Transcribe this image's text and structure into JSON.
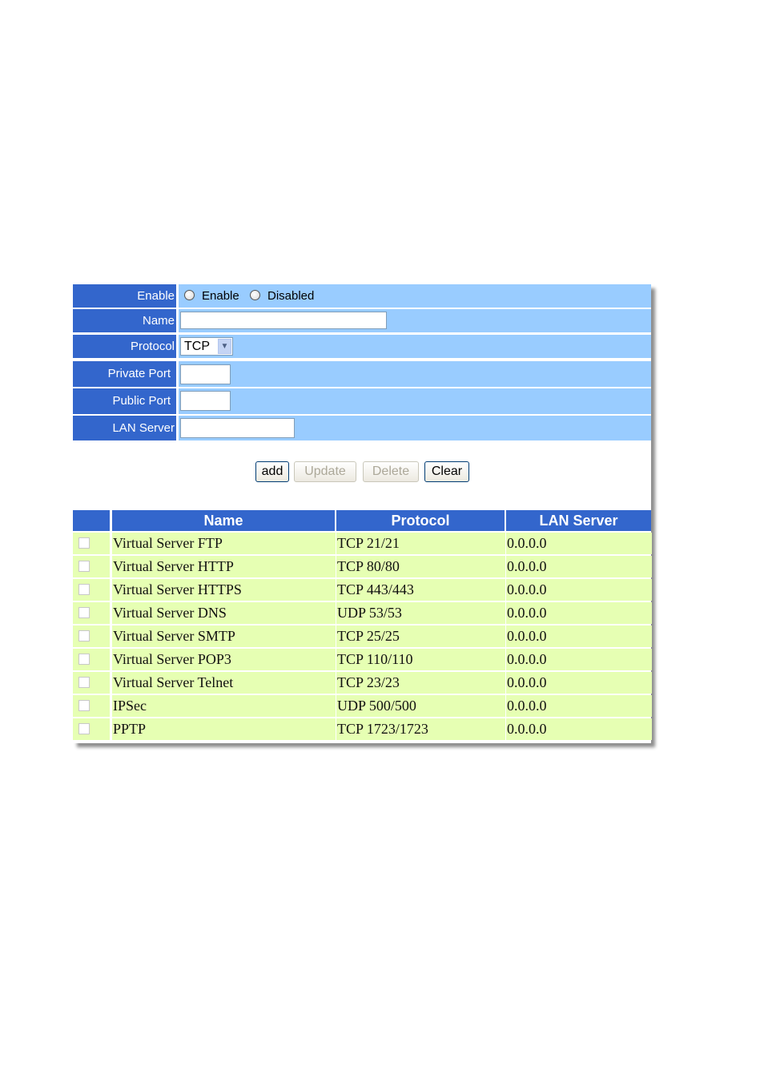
{
  "form": {
    "enable": {
      "label": "Enable",
      "options": [
        "Enable",
        "Disabled"
      ],
      "selected": null
    },
    "name": {
      "label": "Name",
      "value": ""
    },
    "protocol": {
      "label": "Protocol",
      "value": "TCP"
    },
    "private_port": {
      "label": "Private Port",
      "value": ""
    },
    "public_port": {
      "label": "Public Port",
      "value": ""
    },
    "lan_server": {
      "label": "LAN Server",
      "value": ""
    }
  },
  "buttons": {
    "add": "add",
    "update": "Update",
    "delete": "Delete",
    "clear": "Clear"
  },
  "table": {
    "headers": [
      "Name",
      "Protocol",
      "LAN Server"
    ],
    "rows": [
      {
        "name": "Virtual Server FTP",
        "protocol": "TCP 21/21",
        "lan_server": "0.0.0.0",
        "checked": false
      },
      {
        "name": "Virtual Server HTTP",
        "protocol": "TCP 80/80",
        "lan_server": "0.0.0.0",
        "checked": false
      },
      {
        "name": "Virtual Server HTTPS",
        "protocol": "TCP 443/443",
        "lan_server": "0.0.0.0",
        "checked": false
      },
      {
        "name": "Virtual Server DNS",
        "protocol": "UDP 53/53",
        "lan_server": "0.0.0.0",
        "checked": false
      },
      {
        "name": "Virtual Server SMTP",
        "protocol": "TCP 25/25",
        "lan_server": "0.0.0.0",
        "checked": false
      },
      {
        "name": "Virtual Server POP3",
        "protocol": "TCP 110/110",
        "lan_server": "0.0.0.0",
        "checked": false
      },
      {
        "name": "Virtual Server Telnet",
        "protocol": "TCP 23/23",
        "lan_server": "0.0.0.0",
        "checked": false
      },
      {
        "name": "IPSec",
        "protocol": "UDP 500/500",
        "lan_server": "0.0.0.0",
        "checked": false
      },
      {
        "name": "PPTP",
        "protocol": "TCP 1723/1723",
        "lan_server": "0.0.0.0",
        "checked": false
      }
    ]
  },
  "colors": {
    "label_bg": "#3366cc",
    "value_bg": "#99ccff",
    "row_bg": "#e6ffb3"
  }
}
